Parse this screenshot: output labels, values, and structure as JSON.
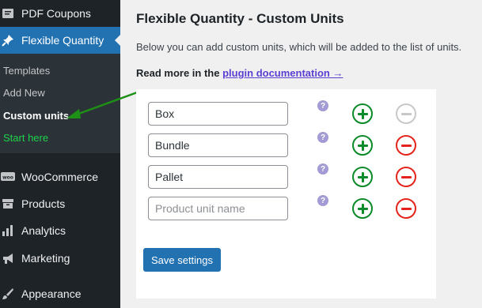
{
  "sidebar": {
    "pdf_coupons": "PDF Coupons",
    "flexible_quantity": "Flexible Quantity",
    "submenu": [
      "Templates",
      "Add New",
      "Custom units",
      "Start here"
    ],
    "woocommerce": "WooCommerce",
    "woo_badge": "woo",
    "products": "Products",
    "analytics": "Analytics",
    "marketing": "Marketing",
    "appearance": "Appearance"
  },
  "page": {
    "title": "Flexible Quantity - Custom Units",
    "description": "Below you can add custom units, which will be added to the list of units.",
    "read_more": "Read more in the",
    "doc_link": "plugin documentation →"
  },
  "units": [
    {
      "value": "Box",
      "remove_disabled": true
    },
    {
      "value": "Bundle",
      "remove_disabled": false
    },
    {
      "value": "Pallet",
      "remove_disabled": false
    },
    {
      "value": "",
      "remove_disabled": false
    }
  ],
  "placeholder": "Product unit name",
  "help_glyph": "?",
  "save_label": "Save settings",
  "colors": {
    "accent": "#2271b1",
    "add": "#0b8a2a",
    "remove": "#e4241c",
    "arrow": "#1e8f17"
  }
}
